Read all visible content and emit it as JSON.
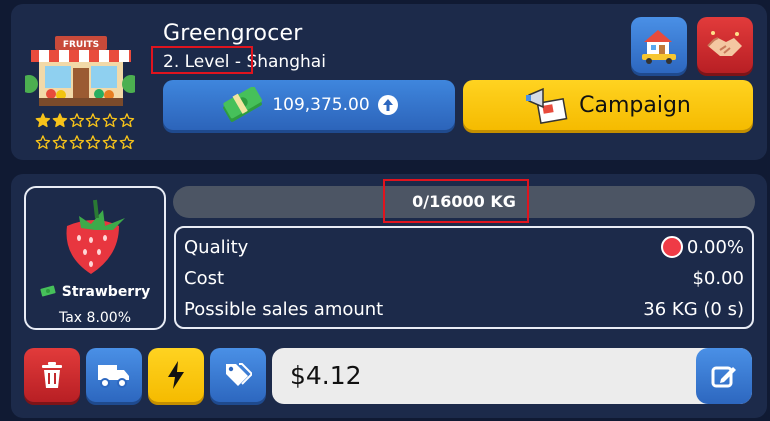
{
  "shop": {
    "name": "Greengrocer",
    "level_text": "2. Level - ",
    "city": "Shanghai",
    "sign_text": "FRUITS",
    "stars_filled": 2,
    "stars_total": 12
  },
  "actions": {
    "money": "109,375.00",
    "campaign_label": "Campaign"
  },
  "product": {
    "name": "Strawberry",
    "tax": "Tax 8.00%"
  },
  "stock": {
    "text": "0/16000 KG",
    "fill_fraction": 0
  },
  "stats": [
    {
      "label": "Quality",
      "value": "0.00%"
    },
    {
      "label": "Cost",
      "value": "$0.00"
    },
    {
      "label": "Possible sales amount",
      "value": "36 KG (0 s)"
    }
  ],
  "price": {
    "value": "$4.12"
  },
  "colors": {
    "background": "#101a33",
    "panel": "#1c2a4a",
    "blue_button": "#3577cc",
    "yellow_button": "#fcc50f",
    "red_button": "#cc2a2e",
    "highlight": "#e0141e"
  }
}
